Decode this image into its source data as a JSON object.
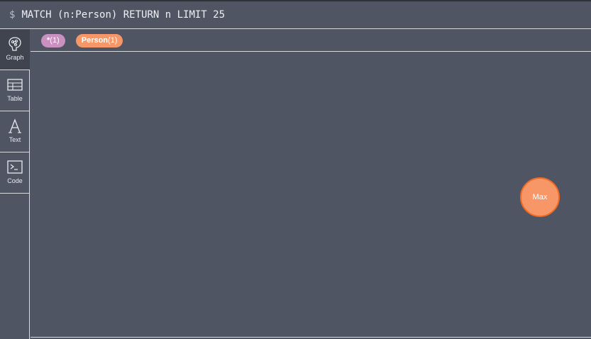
{
  "query": {
    "prompt": "$",
    "text": "MATCH (n:Person) RETURN n LIMIT 25"
  },
  "sidebar": {
    "items": [
      {
        "label": "Graph",
        "icon": "graph-icon",
        "active": true
      },
      {
        "label": "Table",
        "icon": "table-icon",
        "active": false
      },
      {
        "label": "Text",
        "icon": "text-icon",
        "active": false
      },
      {
        "label": "Code",
        "icon": "code-icon",
        "active": false
      }
    ]
  },
  "legend": {
    "labels": [
      {
        "name": "*",
        "count": "(1)",
        "color": "#c990c0"
      },
      {
        "name": "Person",
        "count": "(1)",
        "color": "#f79767"
      }
    ]
  },
  "graph": {
    "nodes": [
      {
        "caption": "Max",
        "label": "Person",
        "color": "#f79767",
        "border": "#f36924"
      }
    ]
  },
  "colors": {
    "background": "#4f5563",
    "divider": "#d7dbe0",
    "active_tab": "#3f444f"
  }
}
